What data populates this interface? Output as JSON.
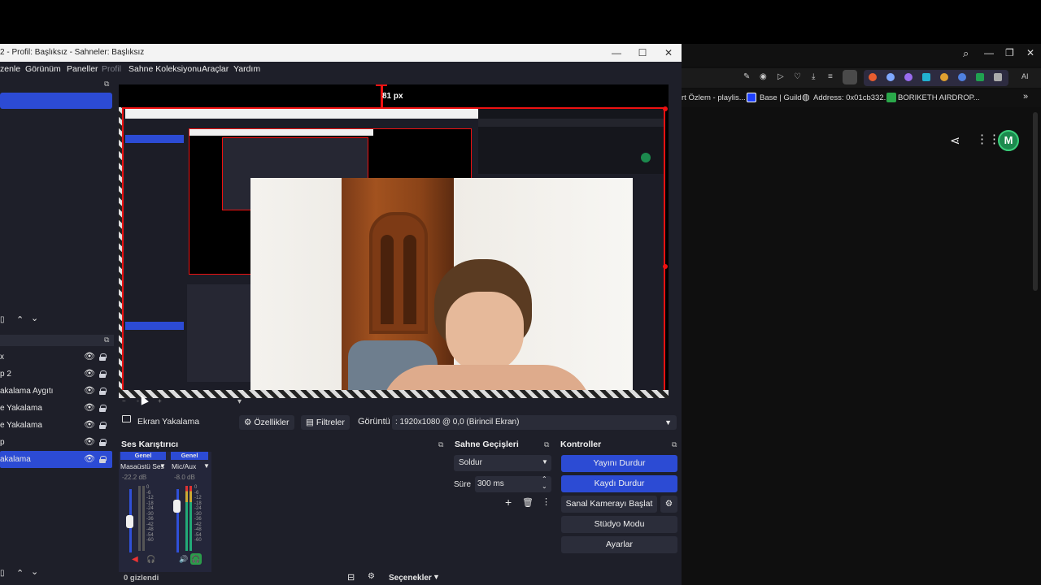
{
  "obs": {
    "title": "2 - Profil: Başlıksız - Sahneler: Başlıksız",
    "menu": [
      "zenle",
      "Görünüm",
      "Paneller",
      "Profil",
      "Sahne Koleksiyonu",
      "Araçlar",
      "Yardım"
    ],
    "preview_guide_label": "81 px",
    "sources": [
      {
        "name": "x",
        "selected": false
      },
      {
        "name": "p 2",
        "selected": false
      },
      {
        "name": "akalama Aygıtı",
        "selected": false
      },
      {
        "name": "e Yakalama",
        "selected": false
      },
      {
        "name": "e Yakalama",
        "selected": false
      },
      {
        "name": "p",
        "selected": false
      },
      {
        "name": "akalama",
        "selected": true
      }
    ],
    "source_toolbar": {
      "current_source": "Ekran Yakalama",
      "properties_label": "Özellikler",
      "filters_label": "Filtreler",
      "display_label": "Görüntü",
      "display_value": ": 1920x1080 @ 0,0 (Birincil Ekran)"
    },
    "mixer": {
      "title": "Ses Karıştırıcı",
      "channels": [
        {
          "tag": "Genel",
          "name": "Masaüstü Ses",
          "db": "-22.2 dB"
        },
        {
          "tag": "Genel",
          "name": "Mic/Aux",
          "db": "-8.0 dB"
        }
      ],
      "scale": [
        "0",
        "-6",
        "-12",
        "-18",
        "-24",
        "-30",
        "-36",
        "-42",
        "-48",
        "-54",
        "-60"
      ],
      "hidden_count": "0 gizlendi",
      "options_label": "Seçenekler"
    },
    "transitions": {
      "title": "Sahne Geçişleri",
      "type": "Soldur",
      "duration_label": "Süre",
      "duration_value": "300 ms"
    },
    "controls": {
      "title": "Kontroller",
      "stop_stream": "Yayını Durdur",
      "stop_recording": "Kaydı Durdur",
      "virtual_cam": "Sanal Kamerayı Başlat",
      "studio_mode": "Stüdyo Modu",
      "settings": "Ayarlar"
    }
  },
  "browser": {
    "bookmarks": [
      "rt Özlem - playlis...",
      "Base | Guild",
      "Address: 0x01cb332...",
      "BORIKETH AIRDROP..."
    ],
    "avatar_letter": "M"
  },
  "colors": {
    "accent": "#2c4bd4",
    "preview_border": "#e11111",
    "dock_bg": "#1e1f29"
  }
}
